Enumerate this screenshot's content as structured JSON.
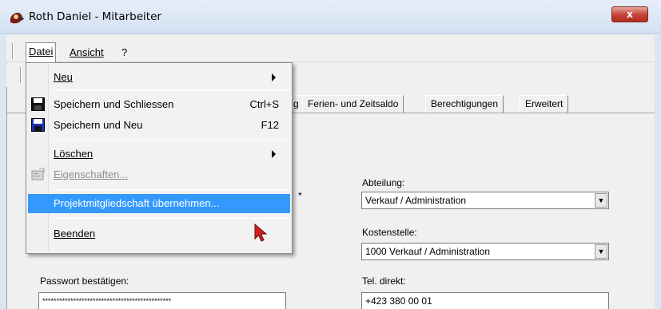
{
  "window": {
    "title": "Roth Daniel - Mitarbeiter",
    "close_glyph": "x"
  },
  "menubar": {
    "datei": "Datei",
    "ansicht": "Ansicht",
    "help": "?"
  },
  "tabs": [
    {
      "label": "g"
    },
    {
      "label": "Ferien- und Zeitsaldo"
    },
    {
      "label": "Berechtigungen"
    },
    {
      "label": "Erweitert"
    }
  ],
  "dropdown": {
    "items": {
      "neu": "Neu",
      "save_close": "Speichern und Schliessen",
      "save_close_shortcut": "Ctrl+S",
      "save_new": "Speichern und Neu",
      "save_new_shortcut": "F12",
      "loeschen": "Löschen",
      "eigenschaften": "Eigenschaften...",
      "projekt": "Projektmitgliedschaft übernehmen...",
      "beenden": "Beenden"
    }
  },
  "form": {
    "required_marker": "*",
    "abteilung_label": "Abteilung:",
    "abteilung_value": "Verkauf / Administration",
    "kostenstelle_label": "Kostenstelle:",
    "kostenstelle_value": "1000 Verkauf / Administration",
    "passwort_label": "Passwort bestätigen:",
    "passwort_value": "**********************************************",
    "tel_label": "Tel. direkt:",
    "tel_value": "+423 380 00 01"
  },
  "icons": {
    "app": "mitarbeiter-app-icon",
    "save": "floppy-disk-icon",
    "properties": "properties-icon"
  },
  "colors": {
    "highlight": "#3399ff",
    "close": "#c8463a"
  }
}
